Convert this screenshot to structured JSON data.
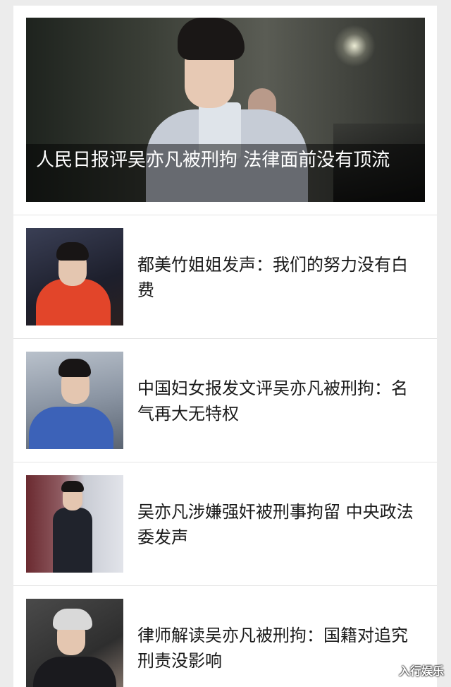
{
  "hero": {
    "caption": "人民日报评吴亦凡被刑拘 法律面前没有顶流"
  },
  "articles": [
    {
      "title": "都美竹姐姐发声：我们的努力没有白费",
      "thumb": "person-in-red-hoodie-photo"
    },
    {
      "title": " 中国妇女报发文评吴亦凡被刑拘：名气再大无特权",
      "thumb": "person-in-blue-shirt-photo"
    },
    {
      "title": "吴亦凡涉嫌强奸被刑事拘留 中央政法委发声",
      "thumb": "person-in-black-outfit-photo"
    },
    {
      "title": "律师解读吴亦凡被刑拘：国籍对追究刑责没影响",
      "thumb": "person-with-silver-hair-photo"
    }
  ],
  "watermark": "入行娱乐",
  "colors": {
    "page_bg": "#ececec",
    "card_bg": "#ffffff",
    "title_text": "#1a1a1a",
    "caption_text": "#ffffff"
  }
}
